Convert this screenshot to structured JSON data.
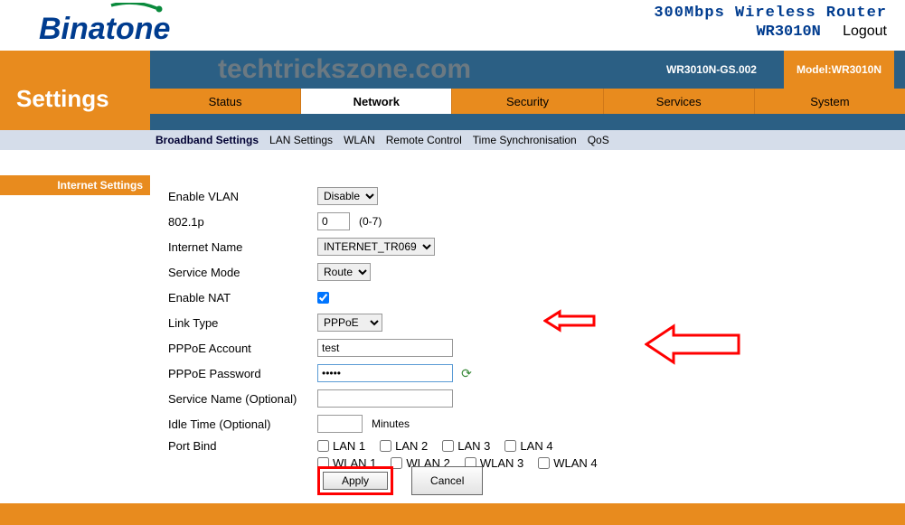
{
  "header": {
    "brand": "Binatone",
    "product_line": "300Mbps Wireless Router",
    "model_short": "WR3010N",
    "logout": "Logout"
  },
  "watermark": "techtrickszone.com",
  "info": {
    "firmware": "WR3010N-GS.002",
    "model_label": "Model:WR3010N"
  },
  "settings_title": "Settings",
  "tabs": [
    "Status",
    "Network",
    "Security",
    "Services",
    "System"
  ],
  "active_tab": "Network",
  "subnav": [
    "Broadband Settings",
    "LAN Settings",
    "WLAN",
    "Remote Control",
    "Time Synchronisation",
    "QoS"
  ],
  "active_subnav": "Broadband Settings",
  "sidebar": {
    "item": "Internet Settings"
  },
  "form": {
    "enable_vlan_label": "Enable VLAN",
    "enable_vlan_value": "Disable",
    "p8021_label": "802.1p",
    "p8021_value": "0",
    "p8021_hint": "(0-7)",
    "internet_name_label": "Internet Name",
    "internet_name_value": "INTERNET_TR069",
    "service_mode_label": "Service Mode",
    "service_mode_value": "Route",
    "enable_nat_label": "Enable NAT",
    "enable_nat_checked": true,
    "link_type_label": "Link Type",
    "link_type_value": "PPPoE",
    "pppoe_account_label": "PPPoE Account",
    "pppoe_account_value": "test",
    "pppoe_password_label": "PPPoE Password",
    "pppoe_password_value": "•••••",
    "service_name_label": "Service Name (Optional)",
    "service_name_value": "",
    "idle_time_label": "Idle Time (Optional)",
    "idle_time_value": "",
    "idle_time_unit": "Minutes",
    "port_bind_label": "Port Bind",
    "port_bind": {
      "lan": [
        "LAN 1",
        "LAN 2",
        "LAN 3",
        "LAN 4"
      ],
      "wlan": [
        "WLAN 1",
        "WLAN 2",
        "WLAN 3",
        "WLAN 4"
      ]
    }
  },
  "buttons": {
    "apply": "Apply",
    "cancel": "Cancel"
  }
}
